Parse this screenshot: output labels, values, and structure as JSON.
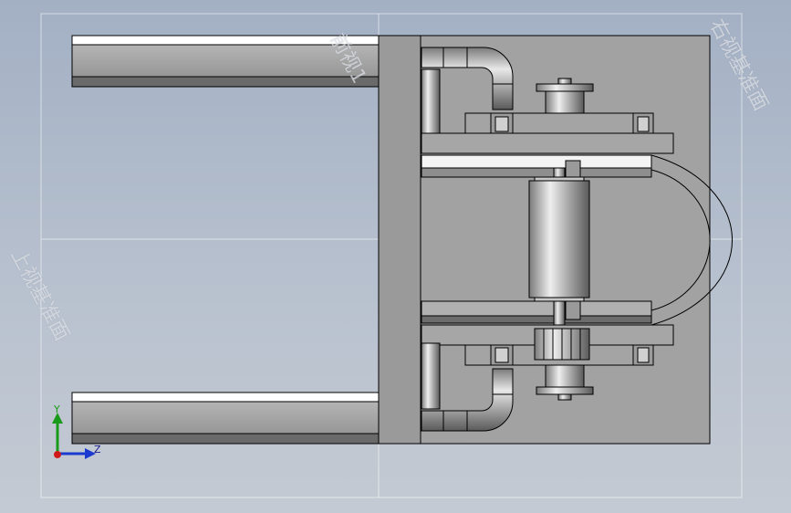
{
  "viewport": {
    "background_top": "#a3b0c4",
    "background_bottom": "#c4cad3",
    "plane_color": "#ffffff",
    "part_fill": "#a0a0a0",
    "part_edge": "#000000"
  },
  "plane_labels": {
    "front": "前视1",
    "right": "右视基准面",
    "top": "上视基准面"
  },
  "triad": {
    "y_label": "Y",
    "z_label": "Z",
    "y_color": "#1a9a1a",
    "z_color": "#1a3ad0",
    "origin_color": "#d01a1a"
  }
}
